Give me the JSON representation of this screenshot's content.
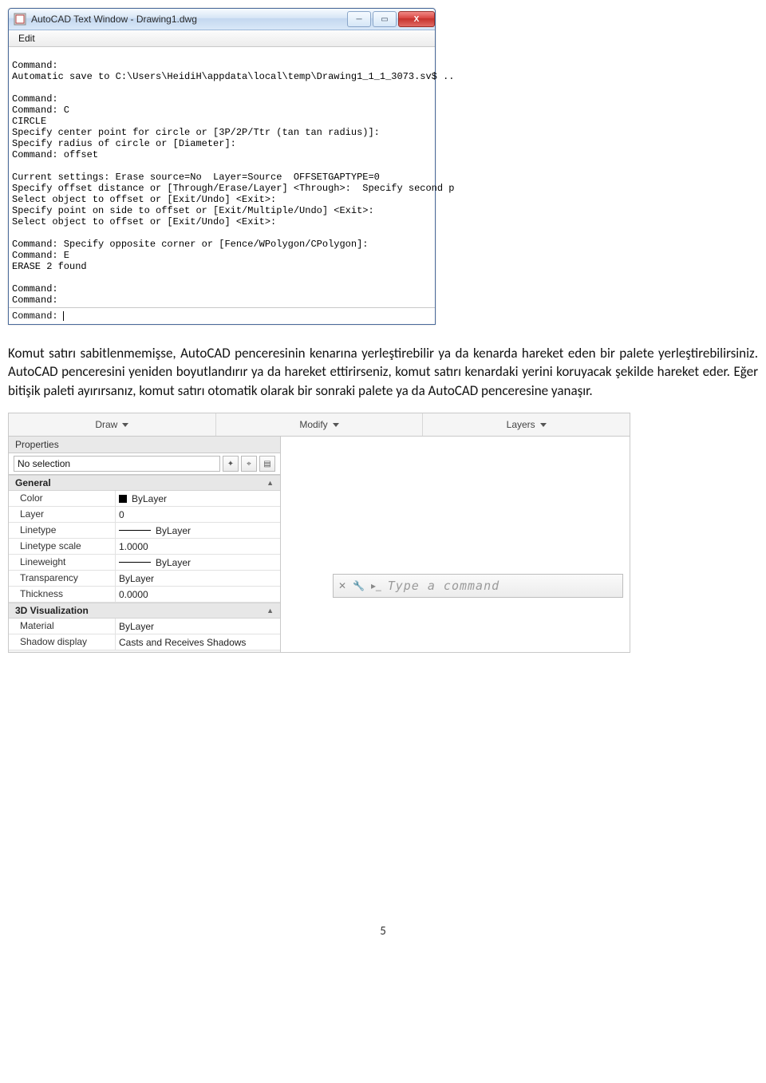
{
  "text_window": {
    "title": "AutoCAD Text Window - Drawing1.dwg",
    "menu_item": "Edit",
    "console": "\nCommand:\nAutomatic save to C:\\Users\\HeidiH\\appdata\\local\\temp\\Drawing1_1_1_3073.sv$ ..\n\nCommand:\nCommand: C\nCIRCLE\nSpecify center point for circle or [3P/2P/Ttr (tan tan radius)]:\nSpecify radius of circle or [Diameter]:\nCommand: offset\n\nCurrent settings: Erase source=No  Layer=Source  OFFSETGAPTYPE=0\nSpecify offset distance or [Through/Erase/Layer] <Through>:  Specify second p\nSelect object to offset or [Exit/Undo] <Exit>:\nSpecify point on side to offset or [Exit/Multiple/Undo] <Exit>:\nSelect object to offset or [Exit/Undo] <Exit>:\n\nCommand: Specify opposite corner or [Fence/WPolygon/CPolygon]:\nCommand: E\nERASE 2 found\n\nCommand:\nCommand:",
    "cmd_prompt": "Command:"
  },
  "paragraph": "Komut satırı sabitlenmemişse, AutoCAD penceresinin kenarına yerleştirebilir ya da kenarda hareket eden bir palete yerleştirebilirsiniz. AutoCAD penceresini yeniden boyutlandırır ya da hareket ettirirseniz, komut satırı kenardaki yerini koruyacak şekilde hareket eder. Eğer bitişik paleti ayırırsanız, komut satırı otomatik olarak bir sonraki palete ya da AutoCAD penceresine yanaşır.",
  "ribbon": {
    "panels": [
      "Draw",
      "Modify",
      "Layers"
    ]
  },
  "properties": {
    "title": "Properties",
    "selection": "No selection",
    "section_general": "General",
    "section_3d": "3D Visualization",
    "rows_general": [
      {
        "k": "Color",
        "v": "ByLayer",
        "swatch": true
      },
      {
        "k": "Layer",
        "v": "0"
      },
      {
        "k": "Linetype",
        "v": "ByLayer",
        "line": true
      },
      {
        "k": "Linetype scale",
        "v": "1.0000"
      },
      {
        "k": "Lineweight",
        "v": "ByLayer",
        "line": true
      },
      {
        "k": "Transparency",
        "v": "ByLayer"
      },
      {
        "k": "Thickness",
        "v": "0.0000"
      }
    ],
    "rows_3d": [
      {
        "k": "Material",
        "v": "ByLayer"
      },
      {
        "k": "Shadow display",
        "v": "Casts and Receives Shadows"
      }
    ]
  },
  "dyn_prompt": {
    "placeholder": "Type a command"
  },
  "page_number": "5"
}
